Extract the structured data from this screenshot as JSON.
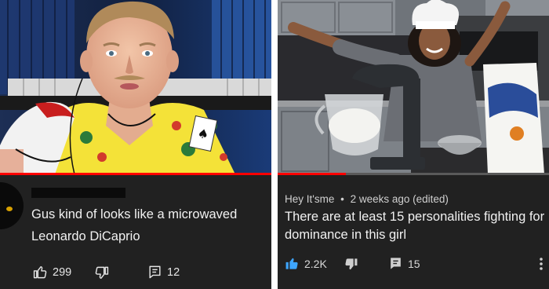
{
  "left": {
    "video_progress": 1.0,
    "comment": {
      "text_line1": "Gus kind of looks like a microwaved",
      "text_line2": "Leonardo DiCaprio",
      "like_count": "299",
      "reply_count": "12"
    },
    "icons": [
      "thumbs-up-icon",
      "thumbs-down-icon",
      "reply-icon"
    ],
    "colors": {
      "progress": "#ff0000",
      "shirt": "#f4e238",
      "background": "#212121"
    }
  },
  "right": {
    "video_progress": 0.25,
    "comment": {
      "author": "Hey It'sme",
      "separator": "•",
      "time": "2 weeks ago (edited)",
      "text_line1": "There are at least 15 personalities fighting for",
      "text_line2": "dominance in this girl",
      "like_count": "2.2K",
      "reply_count": "15"
    },
    "icons": [
      "thumbs-up-icon-active",
      "thumbs-down-icon",
      "reply-icon",
      "more-vert-icon"
    ],
    "colors": {
      "progress": "#ff0000",
      "like_active": "#3ea6ff",
      "background": "#212121"
    }
  }
}
